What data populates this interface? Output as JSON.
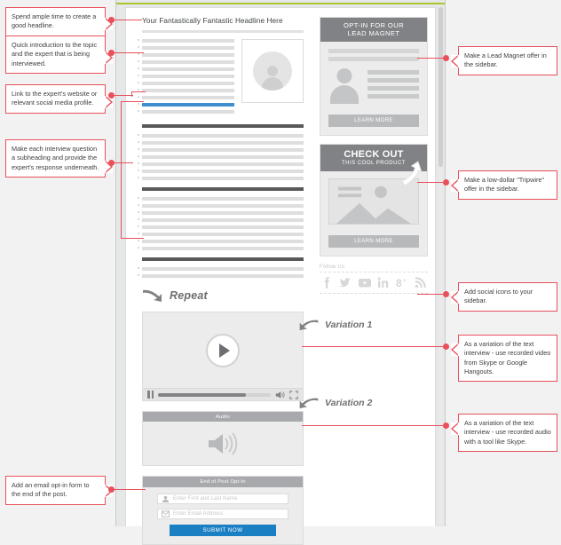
{
  "diagram": {
    "title": "Blog Interview Post Layout Annotation",
    "accent_red": "#e8505b",
    "accent_blue": "#1b7fc4",
    "accent_green": "#aac52e"
  },
  "callouts_left": [
    {
      "id": "headline",
      "text": "Spend ample time to create a good headline."
    },
    {
      "id": "intro",
      "text": "Quick introduction to the topic and the expert that is being interviewed."
    },
    {
      "id": "link",
      "text": "Link to the expert's website or relevant social media profile."
    },
    {
      "id": "questions",
      "text": "Make each interview question a subheading and provide the expert's response underneath."
    },
    {
      "id": "optin",
      "text": "Add an email opt-in form to the end of the post."
    }
  ],
  "callouts_right": [
    {
      "id": "lead-magnet",
      "text": "Make a Lead Magnet offer in the sidebar."
    },
    {
      "id": "tripwire",
      "text": "Make a low-dollar \"Tripwire\" offer in the sidebar."
    },
    {
      "id": "social",
      "text": "Add social icons to your sidebar."
    },
    {
      "id": "video",
      "text": "As a variation of the text interview - use recorded video from Skype or Google Hangouts."
    },
    {
      "id": "audio",
      "text": "As a variation of the text interview - use recorded audio with a tool like Skype."
    }
  ],
  "article": {
    "headline": "Your Fantastically Fantastic Headline Here",
    "repeat_label": "Repeat"
  },
  "variations": [
    {
      "label": "Variation 1"
    },
    {
      "label": "Variation 2"
    }
  ],
  "sidebar": {
    "lead_magnet": {
      "head_line1": "OPT-IN FOR OUR",
      "head_line2": "LEAD MAGNET",
      "cta": "LEARN MORE"
    },
    "tripwire": {
      "head_line1": "CHECK OUT",
      "head_line2": "THIS COOL PRODUCT",
      "cta": "LEARN MORE"
    },
    "follow": {
      "label": "Follow Us",
      "icons": [
        "facebook-icon",
        "twitter-icon",
        "youtube-icon",
        "linkedin-icon",
        "googleplus-icon",
        "rss-icon"
      ]
    }
  },
  "audio_player": {
    "title": "Audio"
  },
  "optin_form": {
    "title": "End of Post Opt-In",
    "name_placeholder": "Enter First and Last Name",
    "email_placeholder": "Enter Email Address",
    "submit_label": "SUBMIT NOW"
  }
}
